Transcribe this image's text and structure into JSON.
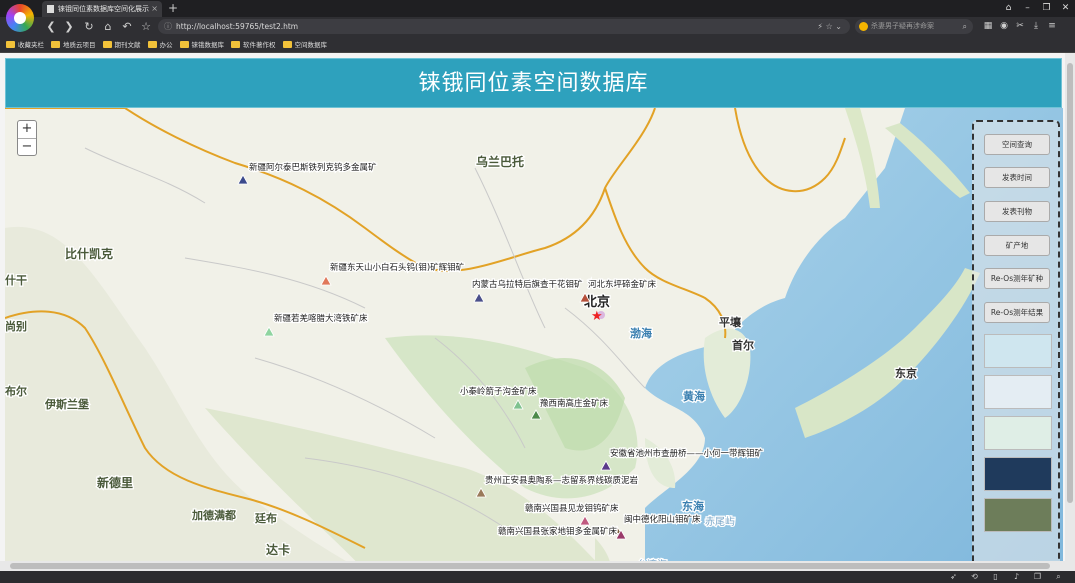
{
  "browser": {
    "tab_title": "铼锇同位素数据库空间化展示",
    "tab_close": "×",
    "new_tab": "+",
    "address_url": "http://localhost:59765/test2.htm",
    "search_placeholder": "杀妻男子疑再涉命案",
    "bookmarks": [
      "收藏夹栏",
      "地质云项目",
      "期刊文献",
      "办公",
      "铼锇数据库",
      "软件著作权",
      "空间数据库"
    ],
    "nav_icons": [
      "back-icon",
      "forward-icon",
      "reload-icon",
      "home-icon",
      "undo-icon",
      "star-icon"
    ],
    "window_controls": [
      "pin-icon",
      "minimize-icon",
      "maximize-icon",
      "close-icon"
    ]
  },
  "page": {
    "title": "铼锇同位素空间数据库"
  },
  "map": {
    "zoom_in": "+",
    "zoom_out": "−",
    "place_labels": {
      "ulaanbaatar": "乌兰巴托",
      "kashgar": "比什凯克",
      "beijing": "北京",
      "bohai": "渤海",
      "pyongyang": "平壤",
      "seoul": "首尔",
      "yellow_sea": "黄海",
      "tokyo": "东京",
      "islamabad": "伊斯兰堡",
      "new_delhi": "新德里",
      "kathmandu": "加德满都",
      "thimphu": "廷布",
      "dhaka": "达卡",
      "east_sea": "东海",
      "akabane": "赤尾屿",
      "taiwan_strait": "台湾海",
      "left1": "什干",
      "left2": "尚别",
      "left3": "布尔"
    },
    "deposits": [
      {
        "name": "新疆阿尔泰巴斯铁列克钨多金属矿",
        "color": "#3b4a8c"
      },
      {
        "name": "新疆东天山小白石头钨(钼)矿辉钼矿",
        "color": "#e0785a"
      },
      {
        "name": "新疆若羌喀腊大湾铁矿床",
        "color": "#8fd4a0"
      },
      {
        "name": "内蒙古乌拉特后旗查干花钼矿",
        "color": "#4a4f8a"
      },
      {
        "name": "河北东坪碲金矿床",
        "color": "#b5503a"
      },
      {
        "name": "小秦岭箭子沟金矿床",
        "color": "#7fc28f"
      },
      {
        "name": "豫西南高庄金矿床",
        "color": "#4c8a4a"
      },
      {
        "name": "安徽省池州市查册桥——小何一带辉钼矿",
        "color": "#5a3a8a"
      },
      {
        "name": "贵州正安县奥陶系—志留系界线碳质泥岩",
        "color": "#9a7a5a"
      },
      {
        "name": "赣南兴国县见龙钼钨矿床",
        "color": "#c05a80"
      },
      {
        "name": "闽中德化阳山钼矿床",
        "color": "#7a5a3a"
      },
      {
        "name": "赣南兴国县张家地钼多金属矿床",
        "color": "#9a3a6a"
      }
    ],
    "beijing_marker_color": "#ee2222"
  },
  "side_panel": {
    "buttons": [
      "空间查询",
      "发表时间",
      "发表刊物",
      "矿产地",
      "Re-Os测年矿种",
      "Re-Os测年结果"
    ],
    "basemap_colors": [
      "#cfe6ef",
      "#e4edf3",
      "#dfeee6",
      "#1f3a5c",
      "#6d7d5a"
    ]
  }
}
